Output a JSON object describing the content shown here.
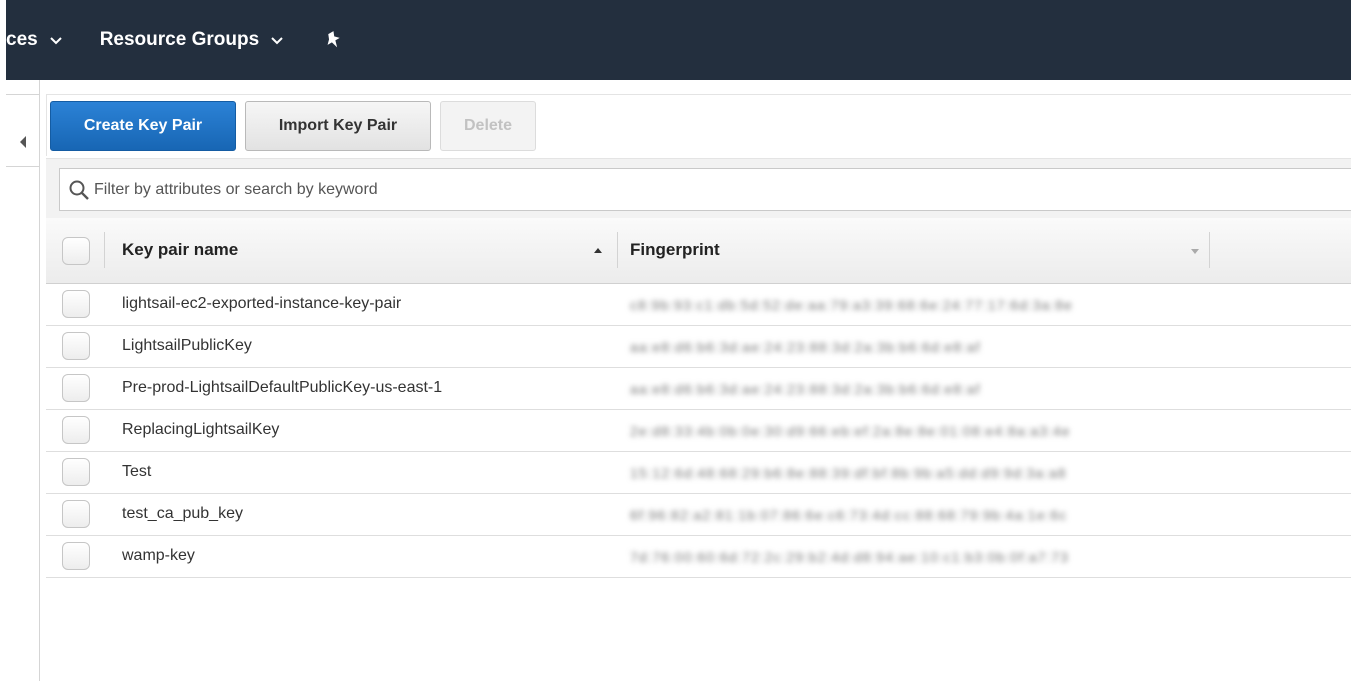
{
  "topnav": {
    "services_label": "ces",
    "services_caret": "⌄",
    "resource_groups_label": "Resource Groups",
    "resource_groups_caret": "⌄",
    "pin_icon": "pin-icon"
  },
  "left_panel": {
    "toggle_icon": "collapse-arrow-icon"
  },
  "toolbar": {
    "create_label": "Create Key Pair",
    "import_label": "Import Key Pair",
    "delete_label": "Delete"
  },
  "filter": {
    "placeholder": "Filter by attributes or search by keyword",
    "icon": "search-icon"
  },
  "table": {
    "headers": {
      "name": "Key pair name",
      "fingerprint": "Fingerprint"
    },
    "rows": [
      {
        "name": "lightsail-ec2-exported-instance-key-pair",
        "fingerprint": "c8:9b:93:c1:db:5d:52:de:aa:79:a3:39:68:6e:24:77:17:6d:3a:8e"
      },
      {
        "name": "LightsailPublicKey",
        "fingerprint": "aa:e8:d6:b6:3d:ae:24:23:88:3d:2a:3b:b6:6d:e8:af"
      },
      {
        "name": "Pre-prod-LightsailDefaultPublicKey-us-east-1",
        "fingerprint": "aa:e8:d6:b6:3d:ae:24:23:88:3d:2a:3b:b6:6d:e8:af"
      },
      {
        "name": "ReplacingLightsailKey",
        "fingerprint": "2e:d8:33:4b:0b:0e:30:d9:66:eb:ef:2a:8e:8e:01:08:e4:8a:a3:4e"
      },
      {
        "name": "Test",
        "fingerprint": "15:12:6d:48:68:29:b6:8e:88:39:df:bf:8b:9b:a5:dd:d9:9d:3a:a8"
      },
      {
        "name": "test_ca_pub_key",
        "fingerprint": "6f:96:82:a2:81:1b:07:86:6e:c6:73:4d:cc:88:68:79:9b:4a:1e:6c"
      },
      {
        "name": "wamp-key",
        "fingerprint": "7d:76:00:60:6d:72:2c:29:b2:4d:d8:94:ae:10:c1:b3:0b:0f:a7:73"
      }
    ]
  }
}
